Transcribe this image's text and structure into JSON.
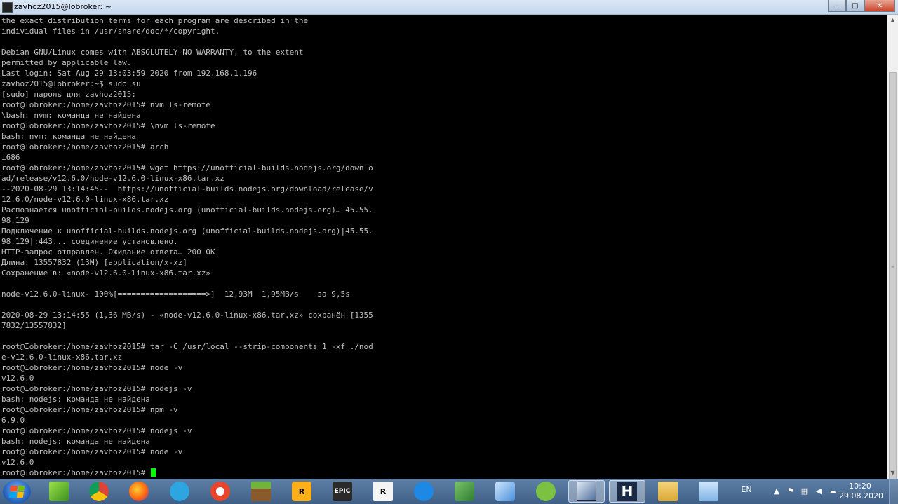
{
  "window": {
    "title": "zavhoz2015@Iobroker: ~",
    "min_glyph": "–",
    "max_glyph": "□",
    "close_glyph": "✕"
  },
  "terminal": {
    "lines": [
      "the exact distribution terms for each program are described in the",
      "individual files in /usr/share/doc/*/copyright.",
      "",
      "Debian GNU/Linux comes with ABSOLUTELY NO WARRANTY, to the extent",
      "permitted by applicable law.",
      "Last login: Sat Aug 29 13:03:59 2020 from 192.168.1.196",
      "zavhoz2015@Iobroker:~$ sudo su",
      "[sudo] пароль для zavhoz2015:",
      "root@Iobroker:/home/zavhoz2015# nvm ls-remote",
      "\\bash: nvm: команда не найдена",
      "root@Iobroker:/home/zavhoz2015# \\nvm ls-remote",
      "bash: nvm: команда не найдена",
      "root@Iobroker:/home/zavhoz2015# arch",
      "i686",
      "root@Iobroker:/home/zavhoz2015# wget https://unofficial-builds.nodejs.org/downlo",
      "ad/release/v12.6.0/node-v12.6.0-linux-x86.tar.xz",
      "--2020-08-29 13:14:45--  https://unofficial-builds.nodejs.org/download/release/v",
      "12.6.0/node-v12.6.0-linux-x86.tar.xz",
      "Распознаётся unofficial-builds.nodejs.org (unofficial-builds.nodejs.org)… 45.55.",
      "98.129",
      "Подключение к unofficial-builds.nodejs.org (unofficial-builds.nodejs.org)|45.55.",
      "98.129|:443... соединение установлено.",
      "HTTP-запрос отправлен. Ожидание ответа… 200 OK",
      "Длина: 13557832 (13M) [application/x-xz]",
      "Сохранение в: «node-v12.6.0-linux-x86.tar.xz»",
      "",
      "node-v12.6.0-linux- 100%[===================>]  12,93M  1,95MB/s    за 9,5s",
      "",
      "2020-08-29 13:14:55 (1,36 MB/s) - «node-v12.6.0-linux-x86.tar.xz» сохранён [1355",
      "7832/13557832]",
      "",
      "root@Iobroker:/home/zavhoz2015# tar -C /usr/local --strip-components 1 -xf ./nod",
      "e-v12.6.0-linux-x86.tar.xz",
      "root@Iobroker:/home/zavhoz2015# node -v",
      "v12.6.0",
      "root@Iobroker:/home/zavhoz2015# nodejs -v",
      "bash: nodejs: команда не найдена",
      "root@Iobroker:/home/zavhoz2015# npm -v",
      "6.9.0",
      "root@Iobroker:/home/zavhoz2015# nodejs -v",
      "bash: nodejs: команда не найдена",
      "root@Iobroker:/home/zavhoz2015# node -v",
      "v12.6.0"
    ],
    "prompt": "root@Iobroker:/home/zavhoz2015#",
    "text_color": "#c0c0c0",
    "cursor_color": "#00ff00"
  },
  "taskbar": {
    "apps": [
      {
        "name": "minecraft-launcher",
        "icon": "green-cube-icon",
        "label": "",
        "active": false
      },
      {
        "name": "chrome",
        "icon": "chrome-icon",
        "label": "",
        "active": false
      },
      {
        "name": "firefox",
        "icon": "firefox-icon",
        "label": "",
        "active": false
      },
      {
        "name": "telegram",
        "icon": "telegram-icon",
        "label": "",
        "active": false
      },
      {
        "name": "ccleaner",
        "icon": "ccleaner-icon",
        "label": "",
        "active": false
      },
      {
        "name": "minecraft",
        "icon": "grass-block-icon",
        "label": "",
        "active": false
      },
      {
        "name": "rockstar-launcher",
        "icon": "rockstar-icon",
        "label": "R",
        "active": false
      },
      {
        "name": "epic-games",
        "icon": "epic-games-icon",
        "label": "EPIC",
        "active": false
      },
      {
        "name": "rockstar-editor",
        "icon": "r-editor-icon",
        "label": "R",
        "active": false
      },
      {
        "name": "cloud-app",
        "icon": "cloud-icon",
        "label": "",
        "active": false
      },
      {
        "name": "network-app",
        "icon": "network-icon",
        "label": "",
        "active": false
      },
      {
        "name": "tools-app",
        "icon": "tools-icon",
        "label": "",
        "active": false
      },
      {
        "name": "leaf-app",
        "icon": "leaf-icon",
        "label": "",
        "active": false
      },
      {
        "name": "putty",
        "icon": "putty-icon",
        "label": "",
        "active": true
      },
      {
        "name": "hex-editor",
        "icon": "h-icon",
        "label": "H",
        "active": true
      },
      {
        "name": "file-explorer",
        "icon": "folder-icon",
        "label": "",
        "active": false
      },
      {
        "name": "notepad",
        "icon": "notepad-icon",
        "label": "",
        "active": false
      }
    ],
    "tray": {
      "language": "EN",
      "time": "10:20",
      "date": "29.08.2020",
      "icons": [
        "chevron-up-icon",
        "flag-icon",
        "network-icon",
        "volume-icon",
        "cloud-icon"
      ]
    }
  }
}
